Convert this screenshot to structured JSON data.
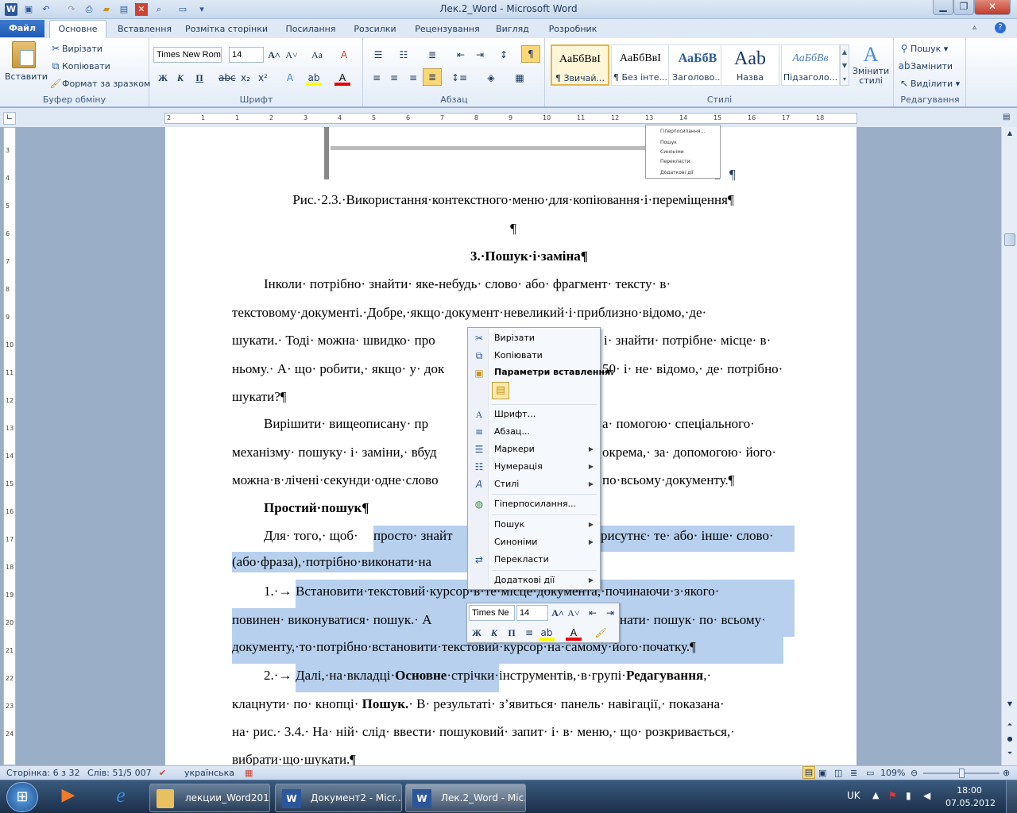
{
  "window": {
    "title": "Лек.2_Word  -  Microsoft Word"
  },
  "tabs": [
    "Файл",
    "Основне",
    "Вставлення",
    "Розмітка сторінки",
    "Посилання",
    "Розсилки",
    "Рецензування",
    "Вигляд",
    "Розробник"
  ],
  "ribbon": {
    "clipboard": {
      "paste": "Вставити",
      "cut": "Вирізати",
      "copy": "Копіювати",
      "format": "Формат за зразком",
      "label": "Буфер обміну"
    },
    "font": {
      "name": "Times New Rom",
      "size": "14",
      "label": "Шрифт"
    },
    "paragraph": {
      "label": "Абзац"
    },
    "styles": {
      "label": "Стилі",
      "items": [
        {
          "preview": "АаБбВвІ",
          "name": "¶ Звичай..."
        },
        {
          "preview": "АаБбВвІ",
          "name": "¶ Без інте..."
        },
        {
          "preview": "АаБбВ",
          "name": "Заголово..."
        },
        {
          "preview": "Aab",
          "name": "Назва"
        },
        {
          "preview": "АаБбВв",
          "name": "Підзаголо..."
        }
      ],
      "change": "Змінити стилі"
    },
    "editing": {
      "find": "Пошук",
      "replace": "Замінити",
      "select": "Виділити",
      "label": "Редагування"
    }
  },
  "ruler": {
    "ticks": [
      "2",
      "1",
      "1",
      "2",
      "3",
      "4",
      "5",
      "6",
      "7",
      "8",
      "9",
      "10",
      "11",
      "12",
      "13",
      "14",
      "15",
      "16",
      "17",
      "18"
    ],
    "vticks": [
      "3",
      "4",
      "5",
      "6",
      "7",
      "8",
      "9",
      "10",
      "11",
      "12",
      "13",
      "14",
      "15",
      "16",
      "17",
      "18",
      "19",
      "20",
      "21",
      "22",
      "23",
      "24"
    ]
  },
  "thumb": {
    "items": [
      "Гіперпосилання...",
      "Пошук",
      "Синоніми",
      "Перекласти",
      "Додаткові дії"
    ],
    "mark": "¶"
  },
  "doc": {
    "caption": "Рис.·2.3.·Використання·контекстного·меню·для·копіювання·і·переміщення¶",
    "pilcrow": "¶",
    "heading": "3.·Пошук·і·заміна¶",
    "p1l1": "Інколи· потрібно· знайти· яке-небудь· слово· або· фрагмент· тексту· в·",
    "p1l2": "текстовому·документі.·Добре,·якщо·документ·невеликий·і·приблизно·відомо,·де·",
    "p1l3a": "шукати.· Тоді· можна· швидко· про",
    "p1l3b": "і· знайти· потрібне· місце· в·",
    "p1l4a": "ньому.· А· що· робити,· якщо· у· док",
    "p1l4b": "50· і· не· відомо,· де· потрібно·",
    "p1l5": "шукати?¶",
    "p2l1a": "Вирішити· вищеописану· пр",
    "p2l1b": "а· помогою· спеціального·",
    "p2l2a": "механізму· пошуку· і· заміни,· вбуд",
    "p2l2b": "окрема,· за· допомогою· його·",
    "p2l3a": "можна·в·лічені·секунди·одне·слово",
    "p2l3b": "по·всьому·документу.¶",
    "sub": "Простий·пошук¶",
    "p3l1a": "Для· того,· щоб·",
    "p3l1b": "просто· знайт",
    "p3l1c": "рисутнє· те· або· інше· слово·",
    "p3l2": "(або·фраза),·потрібно·виконати·на",
    "i1num": "1.·→",
    "i1l1": "Встановити·текстовий·курсор·в·те·місце·документа,·починаючи·з·якого·",
    "i1l2a": "повинен· виконуватися· пошук.· А",
    "i1l2b": "нати· пошук· по· всьому·",
    "i1l3": "документу,·то·потрібно·встановити·текстовий·курсор·на·самому·його·початку.¶",
    "i2num": "2.·→",
    "i2l1a": "Далі,·на·вкладці·",
    "i2l1b": "Основне",
    "i2l1c": "·стрічки·",
    "i2l1d": "інструментів,·в·групі·",
    "i2l1e": "Редагування",
    "i2l1f": ",·",
    "i2l2a": "клацнути· по· кнопці· ",
    "i2l2b": "Пошук.",
    "i2l2c": "· В· результаті· з’явиться· панель· навігації,· показана·",
    "i2l3": "на· рис.· 3.4.· На· ній· слід· ввести· пошуковий· запит· і· в· меню,· що· розкривається,·",
    "i2l4": "вибрати·що·шукати.¶"
  },
  "ctx": {
    "cut": "Вирізати",
    "copy": "Копіювати",
    "paste_opts": "Параметри вставлення:",
    "font": "Шрифт...",
    "para": "Абзац...",
    "bullets": "Маркери",
    "numbering": "Нумерація",
    "styles": "Стилі",
    "hyperlink": "Гіперпосилання...",
    "find": "Пошук",
    "synonyms": "Синоніми",
    "translate": "Перекласти",
    "more": "Додаткові дії"
  },
  "mini": {
    "font": "Times Ne",
    "size": "14"
  },
  "status": {
    "page": "Сторінка: 6 з 32",
    "words": "Слів: 51/5 007",
    "lang": "українська",
    "zoom": "109%"
  },
  "taskbar": {
    "items": [
      "лекции_Word2010",
      "Документ2 - Micr...",
      "Лек.2_Word - Mic..."
    ],
    "lang": "UK",
    "time": "18:00",
    "date": "07.05.2012"
  }
}
